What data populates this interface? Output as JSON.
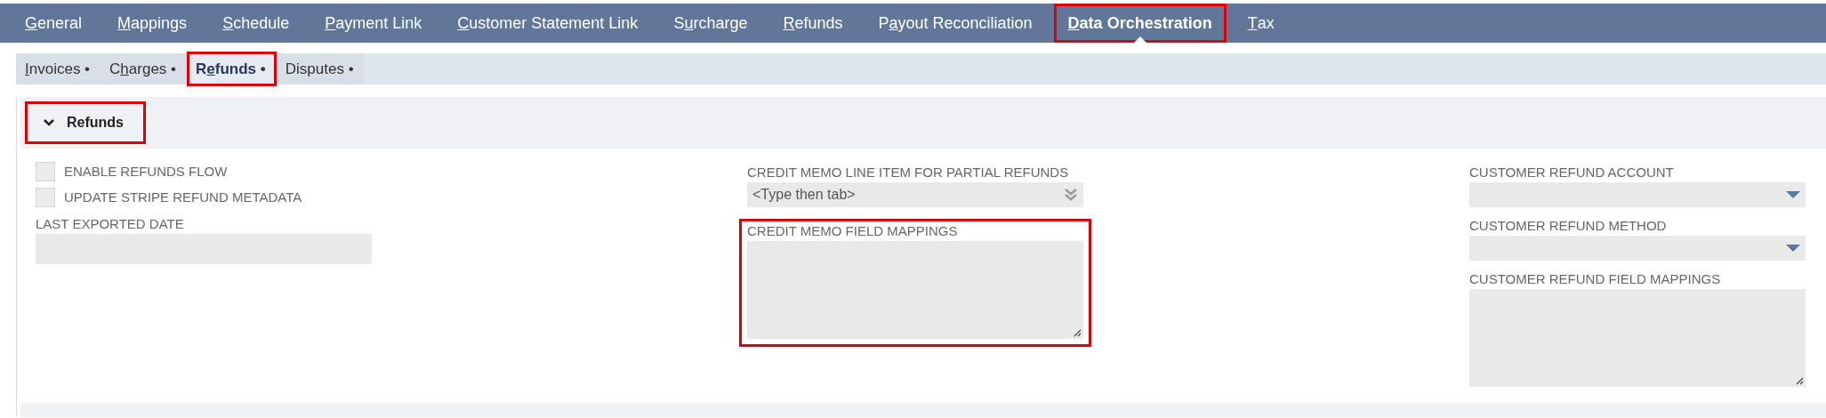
{
  "main_tabs": [
    {
      "key": "G",
      "after": "eneral",
      "selected": false,
      "highlighted": false
    },
    {
      "key": "M",
      "after": "appings",
      "selected": false,
      "highlighted": false
    },
    {
      "key": "S",
      "after": "chedule",
      "selected": false,
      "highlighted": false
    },
    {
      "key": "P",
      "after": "ayment Link",
      "selected": false,
      "highlighted": false
    },
    {
      "key": "C",
      "after": "ustomer Statement Link",
      "selected": false,
      "highlighted": false
    },
    {
      "before": "S",
      "key": "u",
      "after": "rcharge",
      "selected": false,
      "highlighted": false
    },
    {
      "key": "R",
      "after": "efunds",
      "selected": false,
      "highlighted": false
    },
    {
      "before": "P",
      "key": "a",
      "after": "yout Reconciliation",
      "selected": false,
      "highlighted": false
    },
    {
      "key": "D",
      "after": "ata Orchestration",
      "selected": true,
      "highlighted": true
    },
    {
      "key": "T",
      "after": "ax",
      "selected": false,
      "highlighted": false
    }
  ],
  "sub_tabs": [
    {
      "key": "I",
      "after": "nvoices",
      "bullet": "•",
      "selected": false,
      "highlighted": false
    },
    {
      "before": "C",
      "key": "h",
      "after": "arges",
      "bullet": "•",
      "selected": false,
      "highlighted": false
    },
    {
      "before": "R",
      "key": "e",
      "after": "funds",
      "bullet": "•",
      "selected": true,
      "highlighted": true
    },
    {
      "before": "Disputes",
      "bullet": "•",
      "selected": false,
      "highlighted": false
    }
  ],
  "section": {
    "title": "Refunds",
    "expanded": true,
    "highlighted": true,
    "columns": [
      [
        {
          "kind": "checkbox",
          "label": "ENABLE REFUNDS FLOW",
          "checked": false
        },
        {
          "kind": "checkbox",
          "label": "UPDATE STRIPE REFUND METADATA",
          "checked": false
        },
        {
          "kind": "text",
          "label": "LAST EXPORTED DATE"
        }
      ],
      [
        {
          "kind": "combo",
          "label": "CREDIT MEMO LINE ITEM FOR PARTIAL REFUNDS",
          "placeholder": "<Type then tab>"
        },
        {
          "kind": "textarea",
          "label": "CREDIT MEMO FIELD MAPPINGS",
          "highlighted": true
        }
      ],
      [
        {
          "kind": "select",
          "label": "CUSTOMER REFUND ACCOUNT"
        },
        {
          "kind": "select",
          "label": "CUSTOMER REFUND METHOD"
        },
        {
          "kind": "textarea",
          "label": "CUSTOMER REFUND FIELD MAPPINGS"
        }
      ]
    ]
  }
}
